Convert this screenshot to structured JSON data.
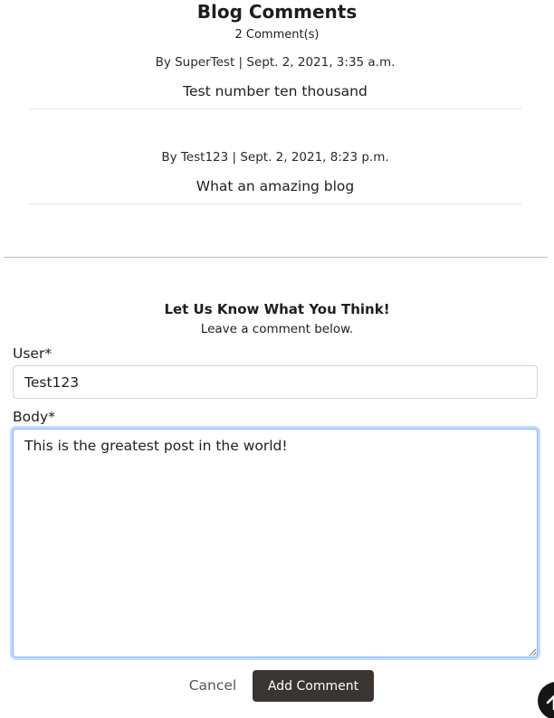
{
  "comments_section": {
    "heading": "Blog Comments",
    "count_text": "2 Comment(s)",
    "comments": [
      {
        "meta": "By SuperTest | Sept. 2, 2021, 3:35 a.m.",
        "body": "Test number ten thousand"
      },
      {
        "meta": "By Test123 | Sept. 2, 2021, 8:23 p.m.",
        "body": "What an amazing blog"
      }
    ]
  },
  "form": {
    "title": "Let Us Know What You Think!",
    "subtitle": "Leave a comment below.",
    "user_label": "User*",
    "user_value": "Test123",
    "body_label": "Body*",
    "body_value": "This is the greatest post in the world!",
    "cancel_label": "Cancel",
    "submit_label": "Add Comment"
  },
  "scroll_top": {
    "icon": "arrow-up-icon"
  },
  "colors": {
    "submit_button": "#3b3532",
    "focus_ring": "#86b7fe",
    "scroll_button": "#151515"
  }
}
